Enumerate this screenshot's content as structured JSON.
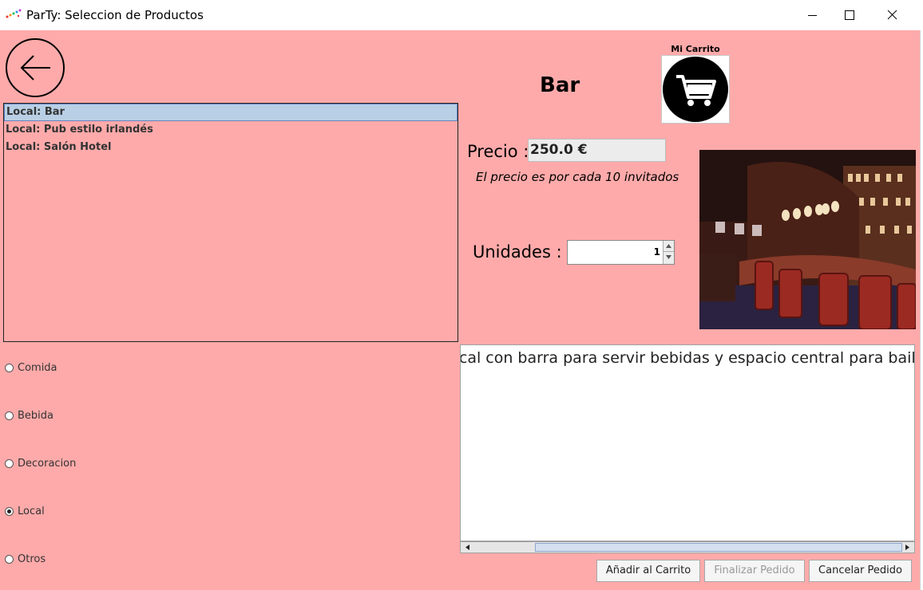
{
  "window": {
    "title": "ParTy: Seleccion de Productos"
  },
  "icons": {
    "back": "arrow-left-icon",
    "cart": "shopping-cart-icon"
  },
  "colors": {
    "background": "#ffaaaa",
    "selection": "#b8cfe5"
  },
  "products": {
    "items": [
      {
        "label": "Local: Bar",
        "selected": true
      },
      {
        "label": "Local: Pub estilo irlandés",
        "selected": false
      },
      {
        "label": "Local: Salón Hotel",
        "selected": false
      }
    ]
  },
  "categories": [
    {
      "label": "Comida",
      "checked": false
    },
    {
      "label": "Bebida",
      "checked": false
    },
    {
      "label": "Decoracion",
      "checked": false
    },
    {
      "label": "Local",
      "checked": true
    },
    {
      "label": "Otros",
      "checked": false
    }
  ],
  "detail": {
    "title": "Bar",
    "cart_label": "Mi Carrito",
    "price_label": "Precio :",
    "price_value": "250.0 €",
    "price_note": "El precio es por cada 10 invitados",
    "units_label": "Unidades :",
    "units_value": "1",
    "description": "Local con barra para servir bebidas y espacio central para bailar"
  },
  "actions": {
    "add": "Añadir al Carrito",
    "finish": "Finalizar Pedido",
    "cancel": "Cancelar Pedido"
  }
}
